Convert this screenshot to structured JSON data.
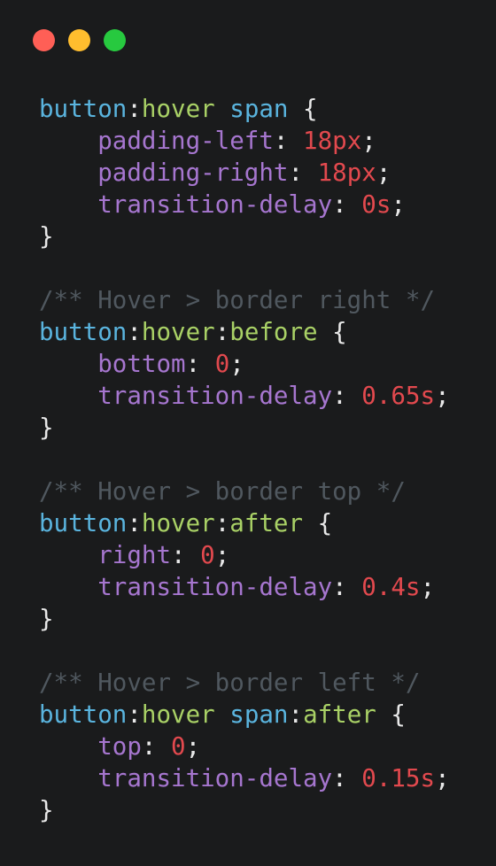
{
  "window": {
    "controls": [
      {
        "name": "close",
        "color": "#ff5f56"
      },
      {
        "name": "minimize",
        "color": "#ffbd2e"
      },
      {
        "name": "maximize",
        "color": "#27c93f"
      }
    ]
  },
  "theme": {
    "background": "#1a1b1c",
    "selector": "#5ab4de",
    "pseudo": "#a9d166",
    "property": "#a676cf",
    "number": "#e2494e",
    "punctuation": "#e8e8e8",
    "comment": "#50585f"
  },
  "code": {
    "lines": [
      [
        {
          "t": "selector",
          "v": "button"
        },
        {
          "t": "punct",
          "v": ":"
        },
        {
          "t": "pseudo",
          "v": "hover"
        },
        {
          "t": "punct",
          "v": " "
        },
        {
          "t": "selector",
          "v": "span"
        },
        {
          "t": "punct",
          "v": " {"
        }
      ],
      [
        {
          "t": "punct",
          "v": "    "
        },
        {
          "t": "prop",
          "v": "padding-left"
        },
        {
          "t": "punct",
          "v": ": "
        },
        {
          "t": "num",
          "v": "18px"
        },
        {
          "t": "punct",
          "v": ";"
        }
      ],
      [
        {
          "t": "punct",
          "v": "    "
        },
        {
          "t": "prop",
          "v": "padding-right"
        },
        {
          "t": "punct",
          "v": ": "
        },
        {
          "t": "num",
          "v": "18px"
        },
        {
          "t": "punct",
          "v": ";"
        }
      ],
      [
        {
          "t": "punct",
          "v": "    "
        },
        {
          "t": "prop",
          "v": "transition-delay"
        },
        {
          "t": "punct",
          "v": ": "
        },
        {
          "t": "num",
          "v": "0s"
        },
        {
          "t": "punct",
          "v": ";"
        }
      ],
      [
        {
          "t": "punct",
          "v": "}"
        }
      ],
      [],
      [
        {
          "t": "comment",
          "v": "/** Hover > border right */"
        }
      ],
      [
        {
          "t": "selector",
          "v": "button"
        },
        {
          "t": "punct",
          "v": ":"
        },
        {
          "t": "pseudo",
          "v": "hover"
        },
        {
          "t": "punct",
          "v": ":"
        },
        {
          "t": "pseudo",
          "v": "before"
        },
        {
          "t": "punct",
          "v": " {"
        }
      ],
      [
        {
          "t": "punct",
          "v": "    "
        },
        {
          "t": "prop",
          "v": "bottom"
        },
        {
          "t": "punct",
          "v": ": "
        },
        {
          "t": "num",
          "v": "0"
        },
        {
          "t": "punct",
          "v": ";"
        }
      ],
      [
        {
          "t": "punct",
          "v": "    "
        },
        {
          "t": "prop",
          "v": "transition-delay"
        },
        {
          "t": "punct",
          "v": ": "
        },
        {
          "t": "num",
          "v": "0.65s"
        },
        {
          "t": "punct",
          "v": ";"
        }
      ],
      [
        {
          "t": "punct",
          "v": "}"
        }
      ],
      [],
      [
        {
          "t": "comment",
          "v": "/** Hover > border top */"
        }
      ],
      [
        {
          "t": "selector",
          "v": "button"
        },
        {
          "t": "punct",
          "v": ":"
        },
        {
          "t": "pseudo",
          "v": "hover"
        },
        {
          "t": "punct",
          "v": ":"
        },
        {
          "t": "pseudo",
          "v": "after"
        },
        {
          "t": "punct",
          "v": " {"
        }
      ],
      [
        {
          "t": "punct",
          "v": "    "
        },
        {
          "t": "prop",
          "v": "right"
        },
        {
          "t": "punct",
          "v": ": "
        },
        {
          "t": "num",
          "v": "0"
        },
        {
          "t": "punct",
          "v": ";"
        }
      ],
      [
        {
          "t": "punct",
          "v": "    "
        },
        {
          "t": "prop",
          "v": "transition-delay"
        },
        {
          "t": "punct",
          "v": ": "
        },
        {
          "t": "num",
          "v": "0.4s"
        },
        {
          "t": "punct",
          "v": ";"
        }
      ],
      [
        {
          "t": "punct",
          "v": "}"
        }
      ],
      [],
      [
        {
          "t": "comment",
          "v": "/** Hover > border left */"
        }
      ],
      [
        {
          "t": "selector",
          "v": "button"
        },
        {
          "t": "punct",
          "v": ":"
        },
        {
          "t": "pseudo",
          "v": "hover"
        },
        {
          "t": "punct",
          "v": " "
        },
        {
          "t": "selector",
          "v": "span"
        },
        {
          "t": "punct",
          "v": ":"
        },
        {
          "t": "pseudo",
          "v": "after"
        },
        {
          "t": "punct",
          "v": " {"
        }
      ],
      [
        {
          "t": "punct",
          "v": "    "
        },
        {
          "t": "prop",
          "v": "top"
        },
        {
          "t": "punct",
          "v": ": "
        },
        {
          "t": "num",
          "v": "0"
        },
        {
          "t": "punct",
          "v": ";"
        }
      ],
      [
        {
          "t": "punct",
          "v": "    "
        },
        {
          "t": "prop",
          "v": "transition-delay"
        },
        {
          "t": "punct",
          "v": ": "
        },
        {
          "t": "num",
          "v": "0.15s"
        },
        {
          "t": "punct",
          "v": ";"
        }
      ],
      [
        {
          "t": "punct",
          "v": "}"
        }
      ]
    ]
  }
}
